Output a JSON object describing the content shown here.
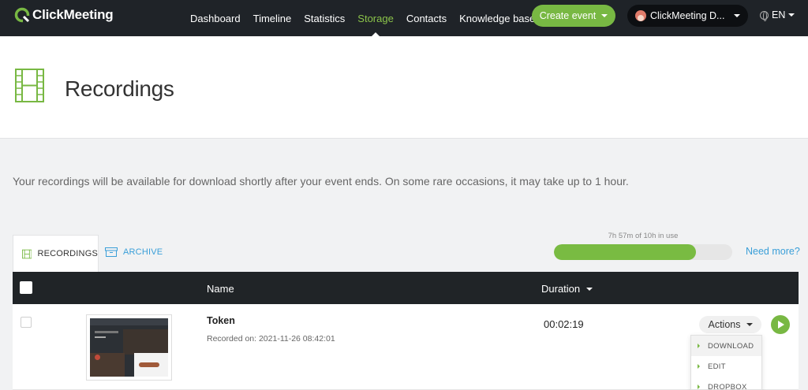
{
  "brand": {
    "name": "ClickMeeting",
    "accent": "#78b843",
    "link": "#3a9fd8",
    "nav_bg": "#1f2328"
  },
  "nav": {
    "items": [
      {
        "label": "Dashboard",
        "active": false
      },
      {
        "label": "Timeline",
        "active": false
      },
      {
        "label": "Statistics",
        "active": false
      },
      {
        "label": "Storage",
        "active": true
      },
      {
        "label": "Contacts",
        "active": false
      },
      {
        "label": "Knowledge base",
        "active": false
      }
    ],
    "create_label": "Create event",
    "account_label": "ClickMeeting D...",
    "language": "EN"
  },
  "page": {
    "title": "Recordings",
    "icon": "film-icon",
    "info": "Your recordings will be available for download shortly after your event ends. On some rare occasions, it may take up to 1 hour."
  },
  "tabs": [
    {
      "label": "RECORDINGS",
      "icon": "film-icon",
      "active": true
    },
    {
      "label": "ARCHIVE",
      "icon": "archive-box-icon",
      "active": false
    }
  ],
  "usage": {
    "label": "7h 57m of 10h in use",
    "fraction": 0.796,
    "need_more": "Need more?"
  },
  "table": {
    "headers": {
      "name": "Name",
      "duration": "Duration"
    },
    "rows": [
      {
        "name": "Token",
        "recorded_on": "Recorded on: 2021-11-26 08:42:01",
        "duration": "00:02:19",
        "actions_label": "Actions"
      }
    ]
  },
  "actions_menu": [
    "DOWNLOAD",
    "EDIT",
    "DROPBOX"
  ]
}
